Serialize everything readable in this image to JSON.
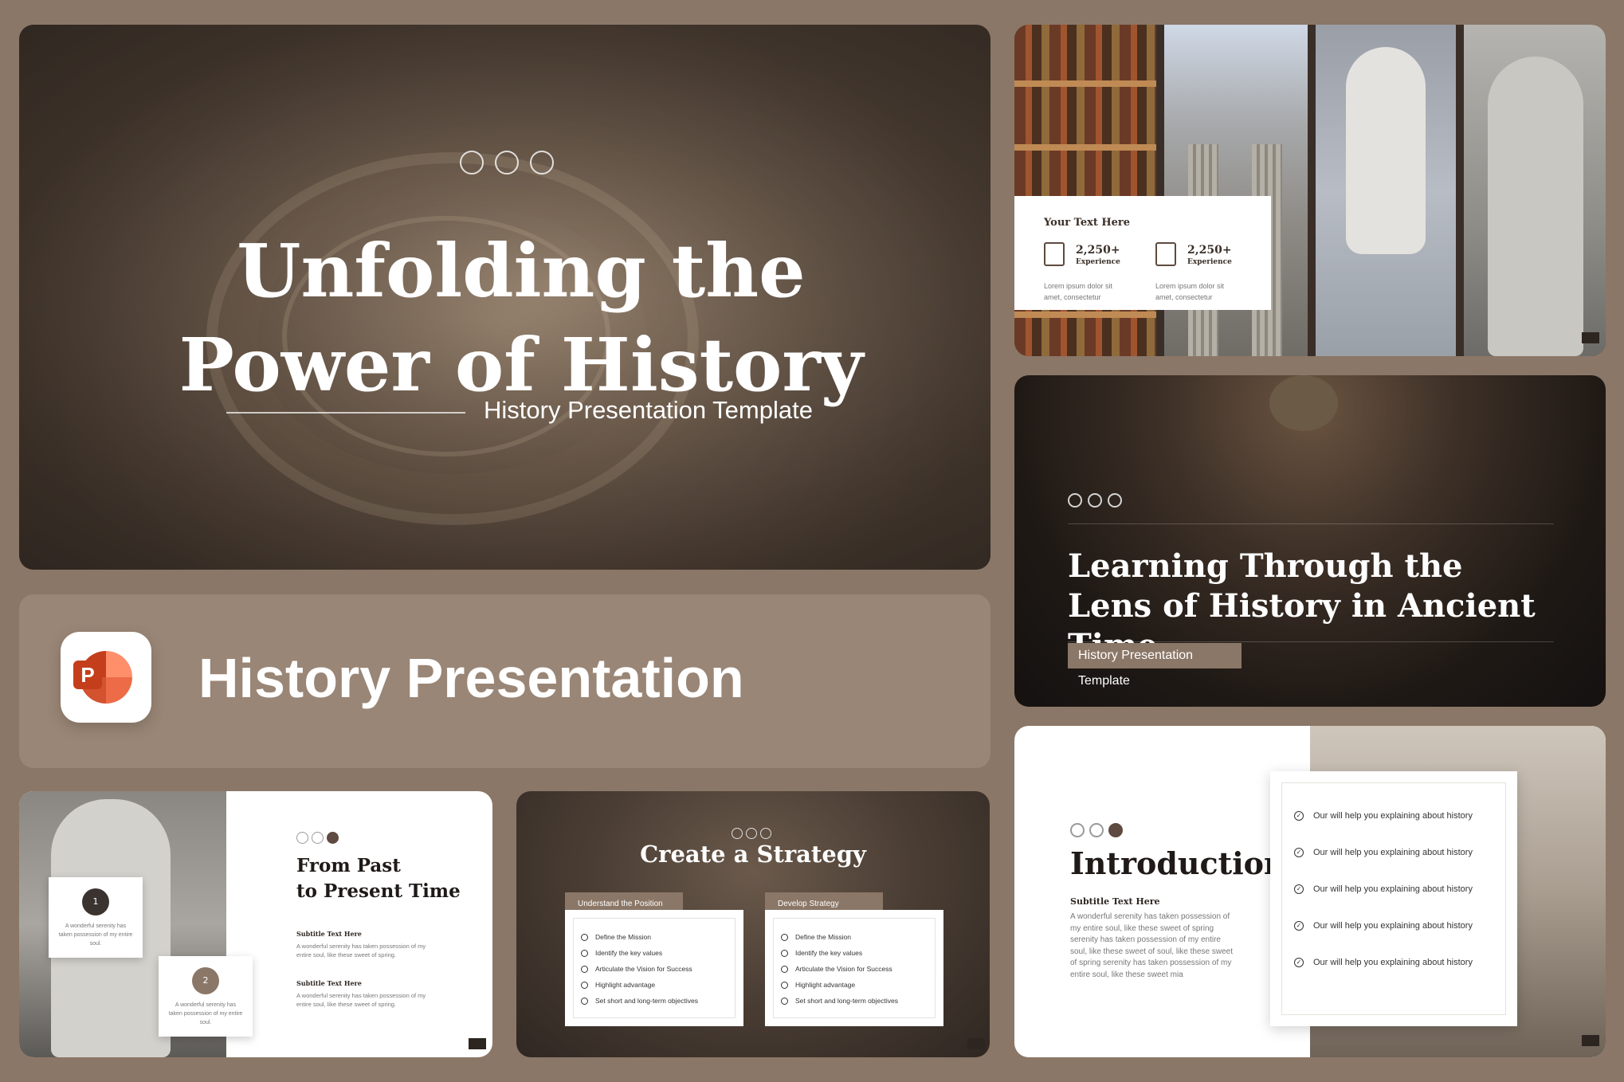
{
  "hero": {
    "title_line1": "Unfolding the",
    "title_line2": "Power of History",
    "subtitle": "History Presentation Template"
  },
  "banner": {
    "app_icon_letter": "P",
    "title": "History Presentation"
  },
  "collage": {
    "heading": "Your Text Here",
    "stats": [
      {
        "value": "2,250+",
        "label": "Experience",
        "text": "Lorem ipsum dolor sit amet, consectetur"
      },
      {
        "value": "2,250+",
        "label": "Experience",
        "text": "Lorem ipsum dolor sit amet, consectetur"
      }
    ]
  },
  "learning": {
    "title_line1": "Learning Through the",
    "title_line2": "Lens of History in Ancient Time",
    "subtitle": "History Presentation Template"
  },
  "intro": {
    "title": "Introduction",
    "subtitle": "Subtitle Text Here",
    "body": "A wonderful serenity has taken possession of my entire soul, like these sweet of spring serenity has taken possession of my entire soul, like these sweet of soul, like these sweet of spring serenity has taken possession of my entire soul, like these sweet mia",
    "checklist": [
      "Our will help you explaining about history",
      "Our will help you explaining about history",
      "Our will help you explaining about history",
      "Our will help you explaining about history",
      "Our will help you explaining about history"
    ]
  },
  "past": {
    "title_line1": "From Past",
    "title_line2": "to Present Time",
    "boxes": [
      {
        "num": "1",
        "text": "A wonderful serenity has taken possession of my entire soul."
      },
      {
        "num": "2",
        "text": "A wonderful serenity has taken possession of my entire soul."
      }
    ],
    "sections": [
      {
        "heading": "Subtitle Text Here",
        "text": "A wonderful serenity has taken possession of my entire soul, like these sweet of spring."
      },
      {
        "heading": "Subtitle Text Here",
        "text": "A wonderful serenity has taken possession of my entire soul, like these sweet of spring."
      }
    ]
  },
  "strategy": {
    "title": "Create a Strategy",
    "columns": [
      {
        "tab": "Understand the Position",
        "items": [
          "Define the Mission",
          "Identify the key values",
          "Articulate the Vision for Success",
          "Highlight advantage",
          "Set short and long-term objectives"
        ]
      },
      {
        "tab": "Develop Strategy",
        "items": [
          "Define the Mission",
          "Identify the key values",
          "Articulate the Vision for Success",
          "Highlight advantage",
          "Set short and long-term objectives"
        ]
      }
    ]
  },
  "colors": {
    "background": "#8b7767",
    "accent": "#8b7767",
    "dark": "#5e4a40"
  }
}
